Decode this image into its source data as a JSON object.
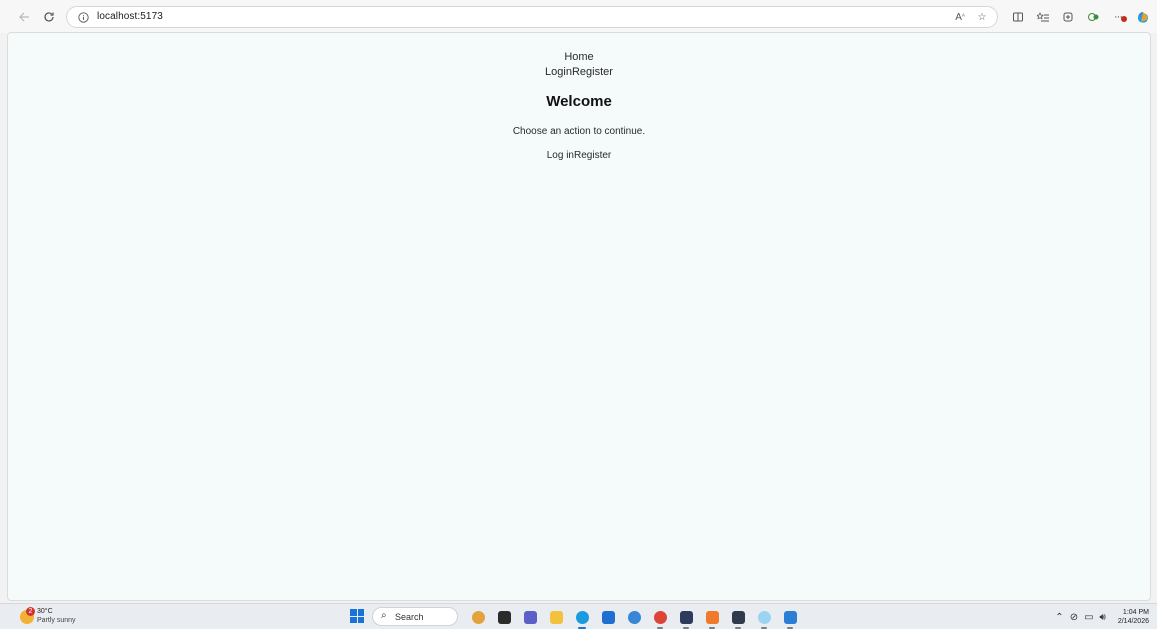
{
  "browser": {
    "url": "localhost:5173",
    "icons": {
      "back": "back-arrow-icon",
      "refresh": "refresh-icon",
      "info": "info-icon",
      "read_aloud": "read-aloud-icon",
      "favorite": "star-icon",
      "split": "split-screen-icon",
      "favorites": "favorites-list-icon",
      "collections": "collections-icon",
      "extensions": "extensions-icon",
      "more": "more-icon",
      "copilot": "copilot-icon"
    }
  },
  "page": {
    "nav": {
      "home": "Home",
      "login": "Login",
      "register": "Register"
    },
    "title": "Welcome",
    "subtitle": "Choose an action to continue.",
    "actions": {
      "login": "Log in",
      "register": "Register"
    }
  },
  "taskbar": {
    "weather": {
      "temp": "30°C",
      "condition": "Partly sunny",
      "badge": "2"
    },
    "search_label": "Search",
    "apps": [
      {
        "name": "widgets",
        "color": "#e2a23c"
      },
      {
        "name": "file-explorer-dark",
        "color": "#2b2b2b"
      },
      {
        "name": "teams",
        "color": "#5b5fc7"
      },
      {
        "name": "file-explorer",
        "color": "#f2c23c"
      },
      {
        "name": "edge",
        "color": "#1a9be0"
      },
      {
        "name": "store",
        "color": "#1f6fd1"
      },
      {
        "name": "paint",
        "color": "#3a86d6"
      },
      {
        "name": "chrome",
        "color": "#db4437"
      },
      {
        "name": "sql",
        "color": "#2e3a5c"
      },
      {
        "name": "xampp",
        "color": "#f07a2b"
      },
      {
        "name": "terminal",
        "color": "#2f3b4a"
      },
      {
        "name": "react-app",
        "color": "#9bd4f2"
      },
      {
        "name": "vscode",
        "color": "#2a7fd4"
      }
    ],
    "clock": {
      "time": "1:04 PM",
      "date": "2/14/2026"
    }
  }
}
